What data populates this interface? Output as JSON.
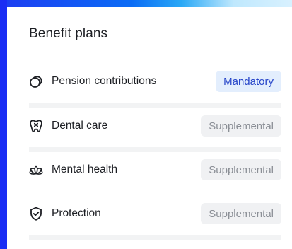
{
  "card": {
    "title": "Benefit plans",
    "plans": [
      {
        "label": "Pension contributions",
        "status": "Mandatory",
        "icon": "pension-icon"
      },
      {
        "label": "Dental care",
        "status": "Supplemental",
        "icon": "tooth-icon"
      },
      {
        "label": "Mental health",
        "status": "Supplemental",
        "icon": "lotus-icon"
      },
      {
        "label": "Protection",
        "status": "Supplemental",
        "icon": "shield-check-icon"
      }
    ]
  },
  "colors": {
    "mandatory_bg": "#e3eefd",
    "mandatory_text": "#2443c8",
    "supplemental_bg": "#f0f1f3",
    "supplemental_text": "#8b8f96",
    "accent_blue": "#1a2df4"
  }
}
